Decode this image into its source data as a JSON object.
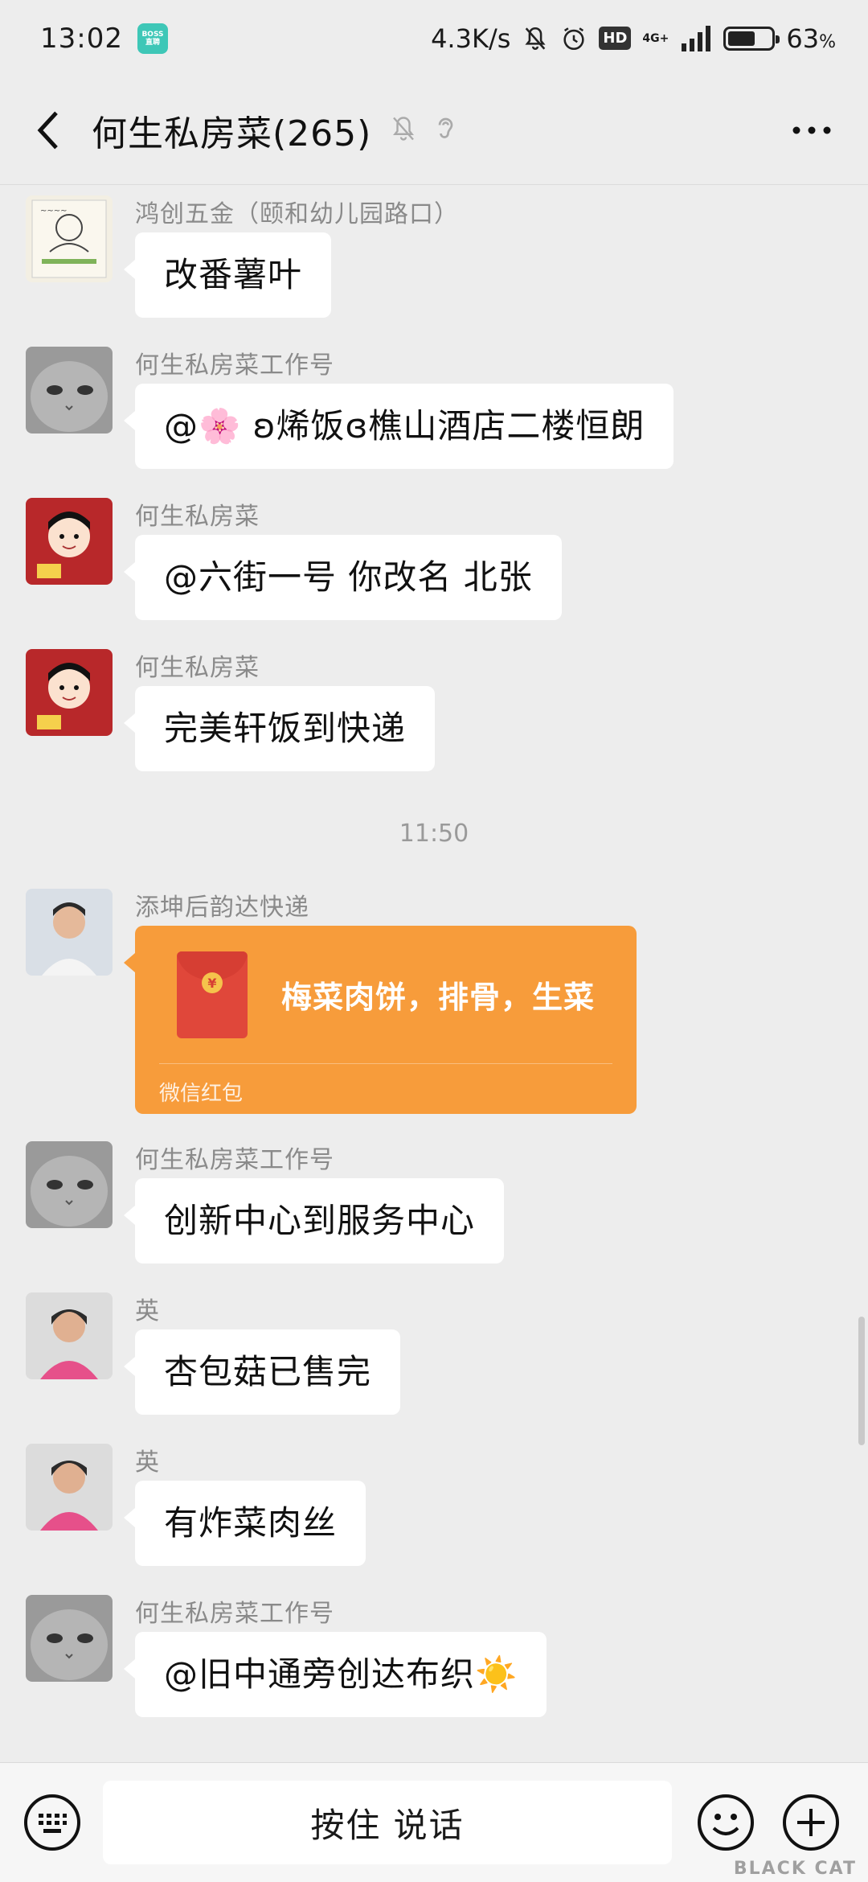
{
  "status_bar": {
    "time": "13:02",
    "app_badge": "BOSS直聘",
    "net_speed": "4.3K/s",
    "hd": "HD",
    "net_type": "4G+",
    "battery_level": 0.63,
    "battery_pct": "63",
    "battery_unit": "%"
  },
  "header": {
    "title": "何生私房菜(265)"
  },
  "messages": [
    {
      "sender": "鸿创五金（颐和幼儿园路口）",
      "text": "改番薯叶",
      "avatar": "drawing-avatar"
    },
    {
      "sender": "何生私房菜工作号",
      "text": "@🌸 ʚ烯饭ɞ樵山酒店二楼恒朗",
      "avatar": "cat-avatar"
    },
    {
      "sender": "何生私房菜",
      "text": "@六街一号  你改名 北张",
      "avatar": "cartoon-avatar"
    },
    {
      "sender": "何生私房菜",
      "text": "完美轩饭到快递",
      "avatar": "cartoon-avatar"
    },
    {
      "sender": "添坤后韵达快递",
      "text": "梅菜肉饼，排骨，生菜",
      "avatar": "man-avatar"
    },
    {
      "sender": "何生私房菜工作号",
      "text": "创新中心到服务中心",
      "avatar": "cat-avatar"
    },
    {
      "sender": "英",
      "text": "杏包菇已售完",
      "avatar": "woman-avatar"
    },
    {
      "sender": "英",
      "text": "有炸菜肉丝",
      "avatar": "woman-avatar"
    },
    {
      "sender": "何生私房菜工作号",
      "text": "@旧中通旁创达布织☀️",
      "avatar": "cat-avatar"
    }
  ],
  "timestamp": "11:50",
  "red_packet": {
    "label": "微信红包",
    "coin_symbol": "¥",
    "color": "#f79c3b"
  },
  "bottom_bar": {
    "voice_label": "按住 说话"
  },
  "watermark": {
    "text": "BLACK CAT"
  }
}
